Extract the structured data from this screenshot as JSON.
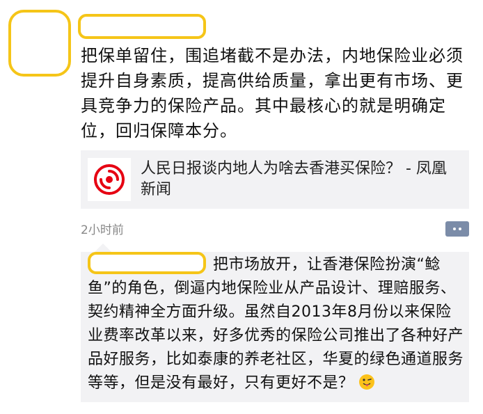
{
  "post": {
    "text": "把保单留住，围追堵截不是办法，内地保险业必须提升自身素质，提高供给质量，拿出更有市场、更具竞争力的保险产品。其中最核心的就是明确定位，回归保障本分。"
  },
  "link_card": {
    "title": "人民日报谈内地人为啥去香港买保险？ - 凤凰新闻",
    "logo_icon": "phoenix-news-logo"
  },
  "timestamp": "2小时前",
  "comment": {
    "text": "把市场放开，让香港保险扮演“鲶鱼”的角色，倒逼内地保险业从产品设计、理赔服务、契约精神全方面升级。虽然自2013年8月份以来保险业费率改革以来，好多优秀的保险公司推出了各种好产品好服务，比如泰康的养老社区，华夏的绿色通道服务等等，但是没有最好，只有更好不是？",
    "emoji_icon": "winking-tongue-face"
  },
  "colors": {
    "highlight": "#f5c518",
    "card_bg": "#f2f2f4",
    "comment_button": "#7b8ca8",
    "logo_red": "#e60012"
  }
}
